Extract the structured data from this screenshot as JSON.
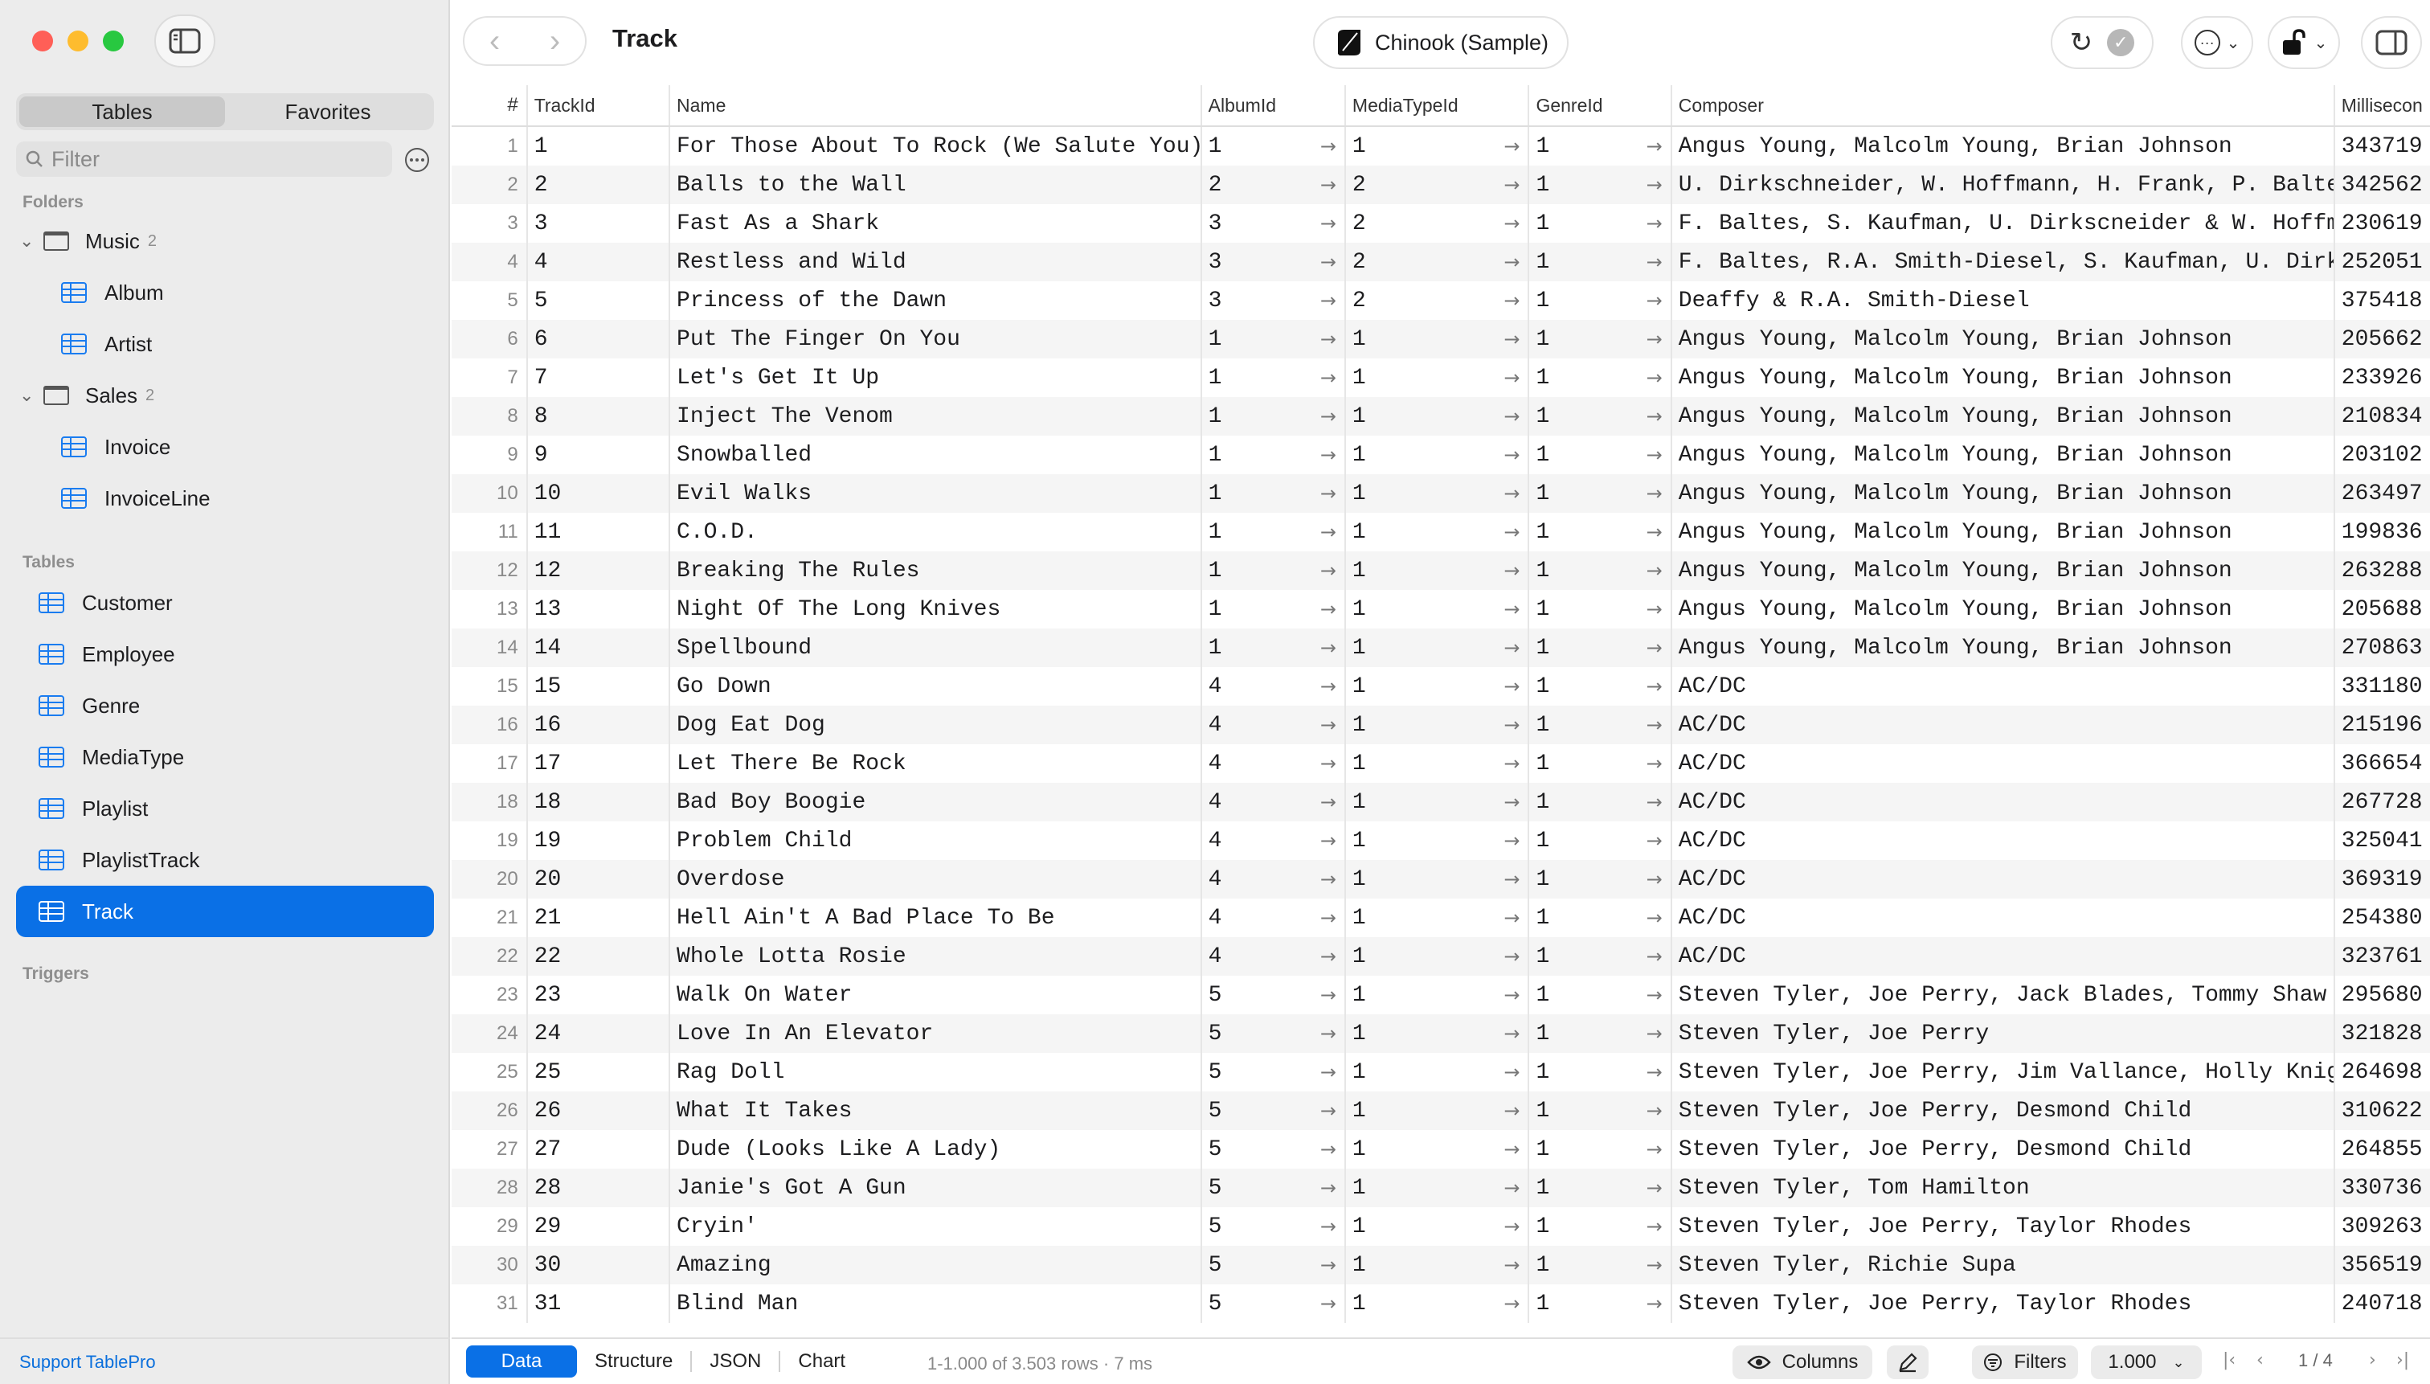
{
  "sidebar": {
    "tabs": [
      "Tables",
      "Favorites"
    ],
    "filter_placeholder": "Filter",
    "sections": {
      "folders": "Folders",
      "tables": "Tables",
      "triggers": "Triggers"
    },
    "folders": [
      {
        "name": "Music",
        "count": "2",
        "items": [
          "Album",
          "Artist"
        ]
      },
      {
        "name": "Sales",
        "count": "2",
        "items": [
          "Invoice",
          "InvoiceLine"
        ]
      }
    ],
    "tables": [
      "Customer",
      "Employee",
      "Genre",
      "MediaType",
      "Playlist",
      "PlaylistTrack",
      "Track"
    ],
    "selected": "Track",
    "support": "Support TablePro"
  },
  "toolbar": {
    "title": "Track",
    "connection": "Chinook (Sample)"
  },
  "grid": {
    "columns": [
      "#",
      "TrackId",
      "Name",
      "AlbumId",
      "MediaTypeId",
      "GenreId",
      "Composer",
      "Millisecon"
    ],
    "rows": [
      [
        "1",
        "1",
        "For Those About To Rock (We Salute You)",
        "1",
        "1",
        "1",
        "Angus Young, Malcolm Young, Brian Johnson",
        "343719"
      ],
      [
        "2",
        "2",
        "Balls to the Wall",
        "2",
        "2",
        "1",
        "U. Dirkschneider, W. Hoffmann, H. Frank, P. Baltes…",
        "342562"
      ],
      [
        "3",
        "3",
        "Fast As a Shark",
        "3",
        "2",
        "1",
        "F. Baltes, S. Kaufman, U. Dirkscneider & W. Hoffman",
        "230619"
      ],
      [
        "4",
        "4",
        "Restless and Wild",
        "3",
        "2",
        "1",
        "F. Baltes, R.A. Smith-Diesel, S. Kaufman, U. Dirks…",
        "252051"
      ],
      [
        "5",
        "5",
        "Princess of the Dawn",
        "3",
        "2",
        "1",
        "Deaffy & R.A. Smith-Diesel",
        "375418"
      ],
      [
        "6",
        "6",
        "Put The Finger On You",
        "1",
        "1",
        "1",
        "Angus Young, Malcolm Young, Brian Johnson",
        "205662"
      ],
      [
        "7",
        "7",
        "Let's Get It Up",
        "1",
        "1",
        "1",
        "Angus Young, Malcolm Young, Brian Johnson",
        "233926"
      ],
      [
        "8",
        "8",
        "Inject The Venom",
        "1",
        "1",
        "1",
        "Angus Young, Malcolm Young, Brian Johnson",
        "210834"
      ],
      [
        "9",
        "9",
        "Snowballed",
        "1",
        "1",
        "1",
        "Angus Young, Malcolm Young, Brian Johnson",
        "203102"
      ],
      [
        "10",
        "10",
        "Evil Walks",
        "1",
        "1",
        "1",
        "Angus Young, Malcolm Young, Brian Johnson",
        "263497"
      ],
      [
        "11",
        "11",
        "C.O.D.",
        "1",
        "1",
        "1",
        "Angus Young, Malcolm Young, Brian Johnson",
        "199836"
      ],
      [
        "12",
        "12",
        "Breaking The Rules",
        "1",
        "1",
        "1",
        "Angus Young, Malcolm Young, Brian Johnson",
        "263288"
      ],
      [
        "13",
        "13",
        "Night Of The Long Knives",
        "1",
        "1",
        "1",
        "Angus Young, Malcolm Young, Brian Johnson",
        "205688"
      ],
      [
        "14",
        "14",
        "Spellbound",
        "1",
        "1",
        "1",
        "Angus Young, Malcolm Young, Brian Johnson",
        "270863"
      ],
      [
        "15",
        "15",
        "Go Down",
        "4",
        "1",
        "1",
        "AC/DC",
        "331180"
      ],
      [
        "16",
        "16",
        "Dog Eat Dog",
        "4",
        "1",
        "1",
        "AC/DC",
        "215196"
      ],
      [
        "17",
        "17",
        "Let There Be Rock",
        "4",
        "1",
        "1",
        "AC/DC",
        "366654"
      ],
      [
        "18",
        "18",
        "Bad Boy Boogie",
        "4",
        "1",
        "1",
        "AC/DC",
        "267728"
      ],
      [
        "19",
        "19",
        "Problem Child",
        "4",
        "1",
        "1",
        "AC/DC",
        "325041"
      ],
      [
        "20",
        "20",
        "Overdose",
        "4",
        "1",
        "1",
        "AC/DC",
        "369319"
      ],
      [
        "21",
        "21",
        "Hell Ain't A Bad Place To Be",
        "4",
        "1",
        "1",
        "AC/DC",
        "254380"
      ],
      [
        "22",
        "22",
        "Whole Lotta Rosie",
        "4",
        "1",
        "1",
        "AC/DC",
        "323761"
      ],
      [
        "23",
        "23",
        "Walk On Water",
        "5",
        "1",
        "1",
        "Steven Tyler, Joe Perry, Jack Blades, Tommy Shaw",
        "295680"
      ],
      [
        "24",
        "24",
        "Love In An Elevator",
        "5",
        "1",
        "1",
        "Steven Tyler, Joe Perry",
        "321828"
      ],
      [
        "25",
        "25",
        "Rag Doll",
        "5",
        "1",
        "1",
        "Steven Tyler, Joe Perry, Jim Vallance, Holly Knight",
        "264698"
      ],
      [
        "26",
        "26",
        "What It Takes",
        "5",
        "1",
        "1",
        "Steven Tyler, Joe Perry, Desmond Child",
        "310622"
      ],
      [
        "27",
        "27",
        "Dude (Looks Like A Lady)",
        "5",
        "1",
        "1",
        "Steven Tyler, Joe Perry, Desmond Child",
        "264855"
      ],
      [
        "28",
        "28",
        "Janie's Got A Gun",
        "5",
        "1",
        "1",
        "Steven Tyler, Tom Hamilton",
        "330736"
      ],
      [
        "29",
        "29",
        "Cryin'",
        "5",
        "1",
        "1",
        "Steven Tyler, Joe Perry, Taylor Rhodes",
        "309263"
      ],
      [
        "30",
        "30",
        "Amazing",
        "5",
        "1",
        "1",
        "Steven Tyler, Richie Supa",
        "356519"
      ],
      [
        "31",
        "31",
        "Blind Man",
        "5",
        "1",
        "1",
        "Steven Tyler, Joe Perry, Taylor Rhodes",
        "240718"
      ]
    ]
  },
  "footer": {
    "tabs": [
      "Data",
      "Structure",
      "JSON",
      "Chart"
    ],
    "active_tab": "Data",
    "rows_info": "1-1.000 of 3.503 rows  ·  7 ms",
    "columns_label": "Columns",
    "filters_label": "Filters",
    "page_size": "1.000",
    "page": "1 / 4"
  },
  "colors": {
    "accent": "#0a70e6",
    "close": "#ff5f57",
    "minimize": "#febc2e",
    "zoom": "#28c840"
  }
}
